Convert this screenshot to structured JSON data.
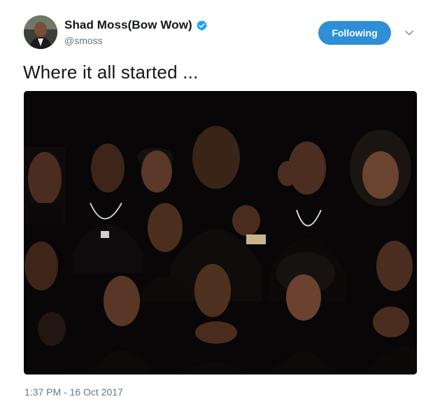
{
  "tweet": {
    "author": {
      "display_name": "Shad Moss(Bow Wow)",
      "handle": "@smoss",
      "verified": true,
      "avatar_icon": "profile-avatar"
    },
    "follow_button": {
      "label": "Following",
      "color": "#2f8fd6"
    },
    "menu_icon": "chevron-down-icon",
    "text": "Where it all started ...",
    "media": {
      "kind": "photo",
      "description_icon": "group-photo"
    },
    "timestamp": "1:37 PM - 16 Oct 2017"
  },
  "colors": {
    "text_primary": "#14171a",
    "text_secondary": "#657786",
    "verified_blue": "#1da1f2",
    "photo_background": "#080606"
  }
}
